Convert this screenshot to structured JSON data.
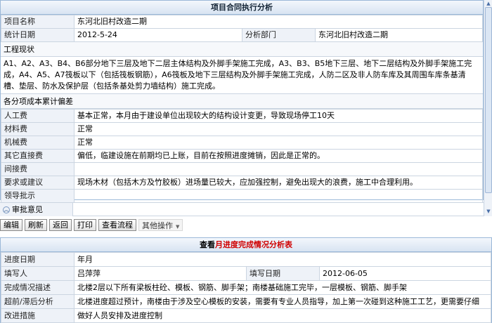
{
  "contract": {
    "title": "项目合同执行分析",
    "project_name_label": "项目名称",
    "project_name": "东河北旧村改造二期",
    "stat_date_label": "统计日期",
    "stat_date": "2012-5-24",
    "dept_label": "分析部门",
    "dept": "东河北旧村改造二期",
    "status_label": "工程现状",
    "status_text": "A1、A2、A3、B4、B6部分地下三层及地下二层主体结构及外脚手架施工完成，A3、B3、B5地下三层、地下二层结构及外脚手架施工完成，A4、A5、A7筏板以下（包括筏板钢筋），A6筏板及地下三层结构及外脚手架施工完成，人防二区及非人防车库及其周围车库条基清槽、垫层、防水及保护层（包括条基处剪力墙结构）施工完成。",
    "deviation_label": "各分项成本累计偏差",
    "rows": [
      {
        "label": "人工费",
        "value": "基本正常，本月由于建设单位出现较大的结构设计变更，导致现场停工10天"
      },
      {
        "label": "材料费",
        "value": "正常"
      },
      {
        "label": "机械费",
        "value": "正常"
      },
      {
        "label": "其它直接费",
        "value": "偏低，临建设施在前期均已上账，目前在按照进度摊销，因此是正常的。"
      },
      {
        "label": "间接费",
        "value": ""
      },
      {
        "label": "要求或建议",
        "value": "现场木材（包括木方及竹胶板）进场量已较大，应加强控制，避免出现大的浪费，施工中合理利用。"
      },
      {
        "label": "领导批示",
        "value": ""
      }
    ],
    "approval_label": "审批意见"
  },
  "toolbar": {
    "edit": "编辑",
    "refresh": "刷新",
    "back": "返回",
    "print": "打印",
    "view_flow": "查看流程",
    "more": "其他操作"
  },
  "progress": {
    "title_prefix": "查看",
    "title_highlight": "月进度完成情况分析表",
    "period_label": "进度日期",
    "period_value": "年月",
    "filler_label": "填写人",
    "filler_value": "吕萍萍",
    "fill_date_label": "填写日期",
    "fill_date_value": "2012-06-05",
    "desc_label": "完成情况描述",
    "desc_value": "北楼2层以下所有梁板柱砼、模板、钢筋、脚手架；南楼基础施工完毕，一层模板、钢筋、脚手架",
    "delay_label": "超前/滞后分析",
    "delay_value": "北楼进度超过预计，南楼由于涉及空心模板的安装，需要有专业人员指导，加上第一次碰到这种施工工艺，更需要仔细",
    "measure_label": "改进措施",
    "measure_value": "做好人员安排及进度控制"
  }
}
